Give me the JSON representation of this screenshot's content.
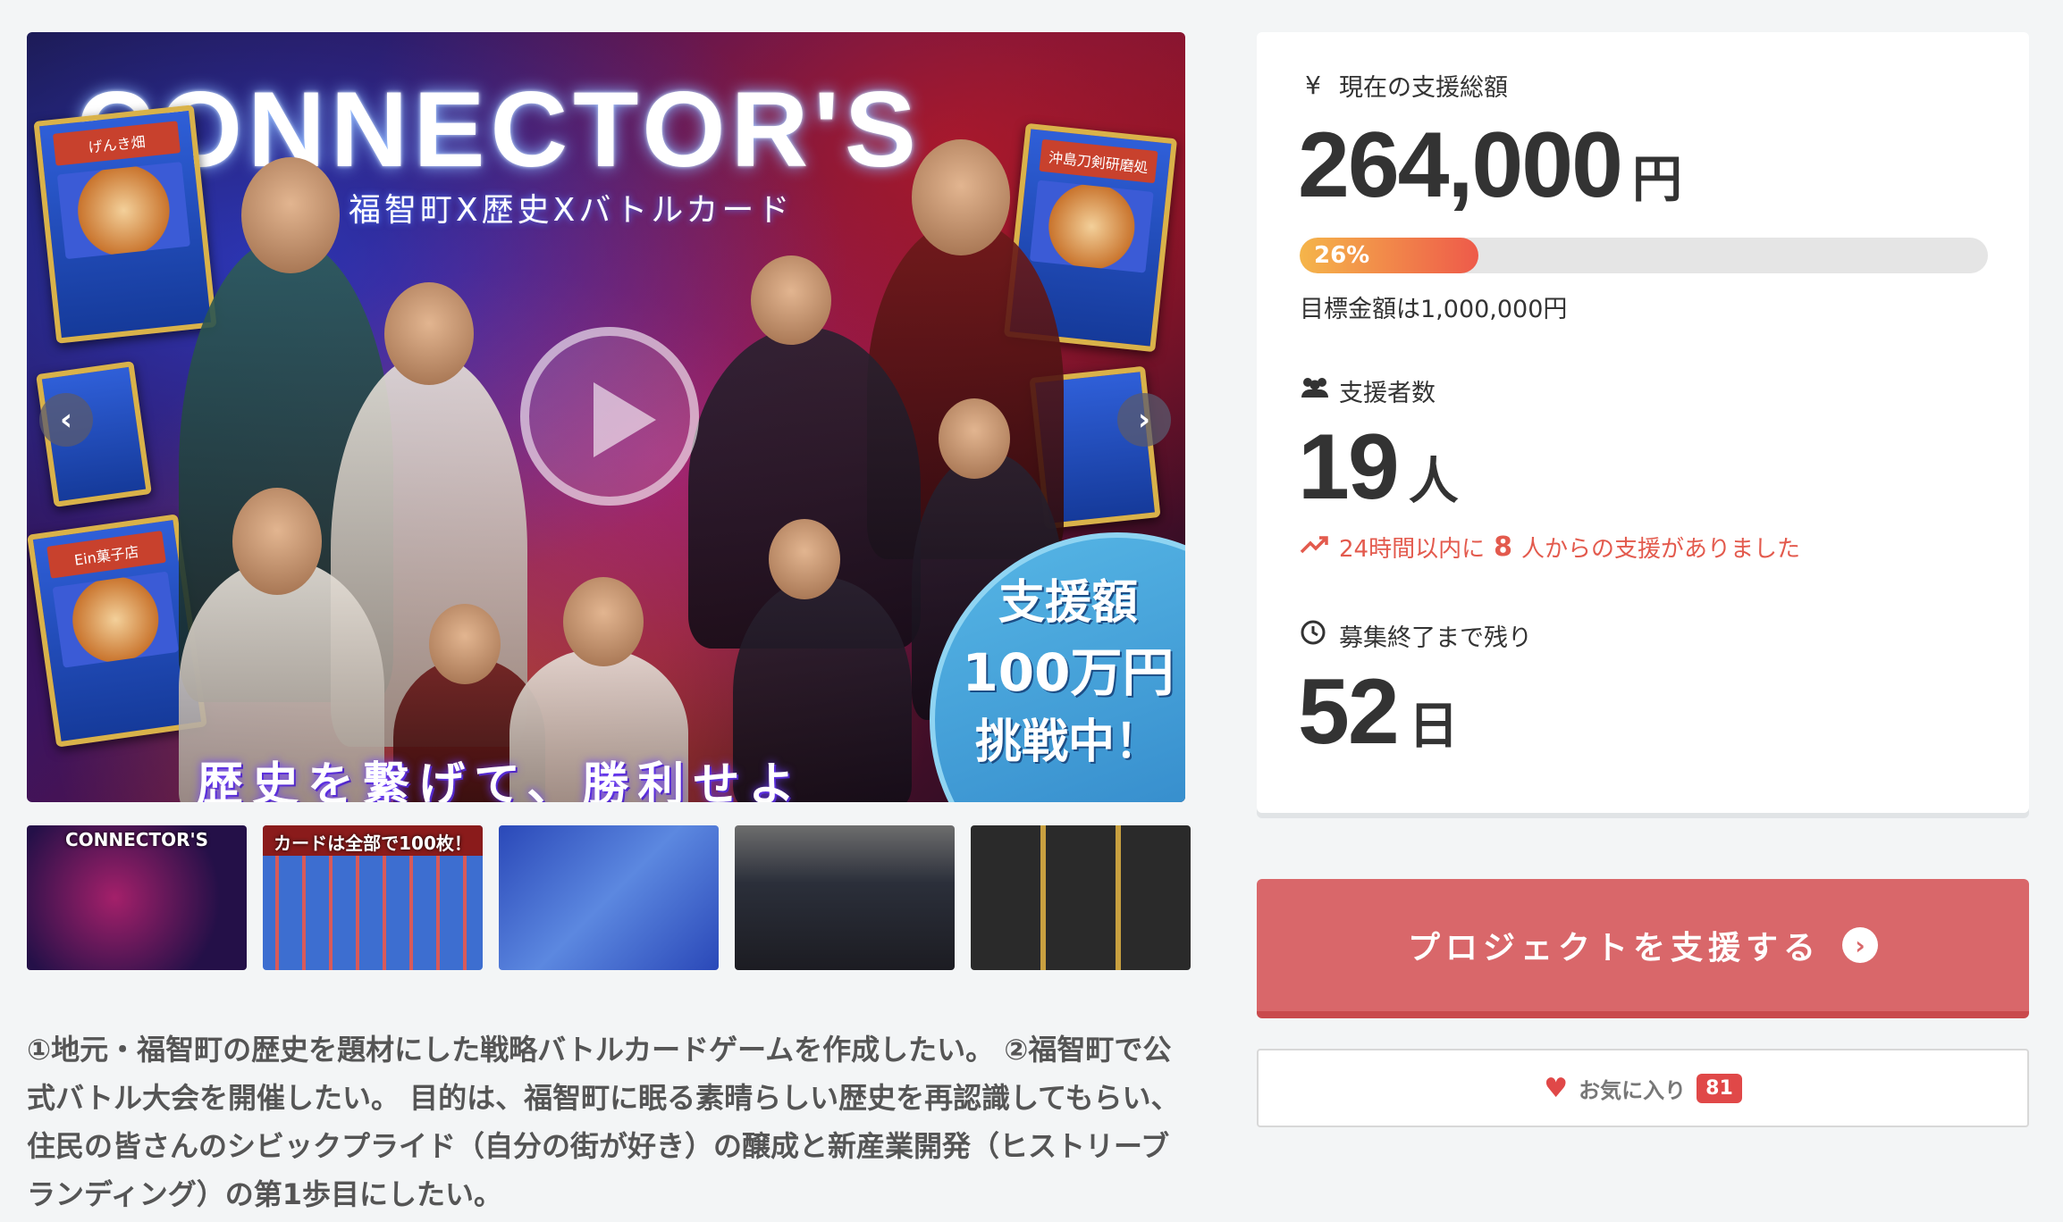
{
  "hero": {
    "title": "CONNECTOR'S",
    "subtitle": "福智町X歴史Xバトルカード",
    "catchphrase": "歴史を繋げて、勝利せよ",
    "badge": [
      "支援額",
      "100万円",
      "挑戦中！"
    ],
    "cards": [
      "げんき畑",
      "沖島刀剣研磨処",
      "Ein菓子店"
    ]
  },
  "thumbnails": [
    {
      "label": "CONNECTOR'S"
    },
    {
      "label": "カードは全部で100枚！"
    },
    {
      "label": ""
    },
    {
      "label": ""
    },
    {
      "label": ""
    }
  ],
  "description": "①地元・福智町の歴史を題材にした戦略バトルカードゲームを作成したい。 ②福智町で公式バトル大会を開催したい。 目的は、福智町に眠る素晴らしい歴史を再認識してもらい、住民の皆さんのシビックプライド（自分の街が好き）の醸成と新産業開発（ヒストリーブランディング）の第1歩目にしたい。",
  "stats": {
    "total_label": "現在の支援総額",
    "total_value": "264,000",
    "total_unit": "円",
    "progress_percent": 26,
    "progress_label": "26%",
    "goal_text": "目標金額は1,000,000円",
    "supporters_label": "支援者数",
    "supporters_value": "19",
    "supporters_unit": "人",
    "trend_pre": "24時間以内に",
    "trend_count": "8",
    "trend_post": "人からの支援がありました",
    "remaining_label": "募集終了まで残り",
    "remaining_value": "52",
    "remaining_unit": "日"
  },
  "actions": {
    "support_label": "プロジェクトを支援する",
    "favorite_label": "お気に入り",
    "favorite_count": "81"
  },
  "colors": {
    "accent": "#d9676a",
    "progress_start": "#f5b54a",
    "progress_end": "#ee5a4a",
    "trend": "#e35a4d",
    "heart": "#e04848"
  }
}
